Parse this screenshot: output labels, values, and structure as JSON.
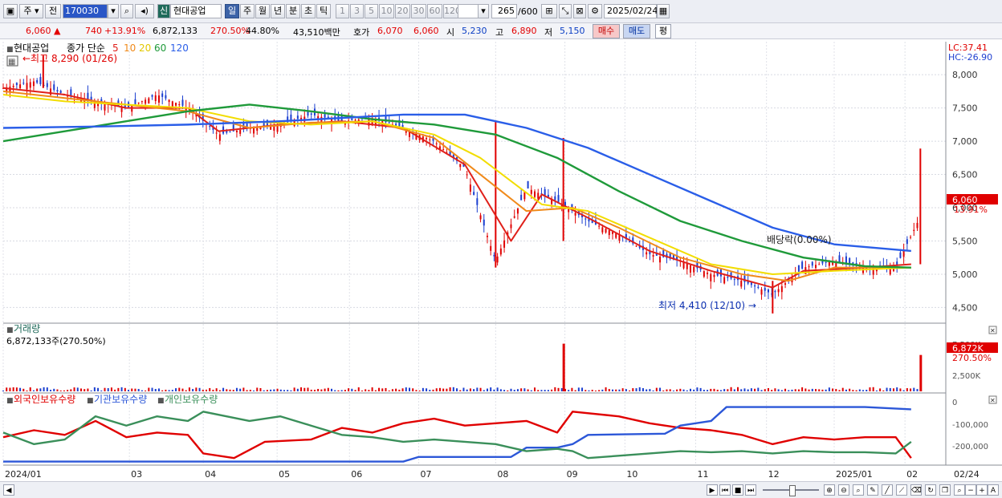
{
  "toolbar": {
    "period_label": "주",
    "prev_label": "전",
    "code": "170030",
    "sin_label": "신",
    "name": "현대공업",
    "periods": [
      "일",
      "주",
      "월",
      "년",
      "분",
      "초",
      "틱"
    ],
    "minutes": [
      "1",
      "3",
      "5",
      "10",
      "20",
      "30",
      "60",
      "120"
    ],
    "count": "265",
    "count_total": "/600",
    "date": "2025/02/24"
  },
  "quote": {
    "price": "6,060",
    "change": "740",
    "change_pct": "+13.91%",
    "volume": "6,872,133",
    "volume_pct": "270.50%",
    "turnover_pct": "44.80%",
    "amount": "43,510백만",
    "hoga_label": "호가",
    "ask": "6,070",
    "bid": "6,060",
    "open_label": "시",
    "open": "5,230",
    "high_label": "고",
    "high": "6,890",
    "low_label": "저",
    "low": "5,150",
    "buy_label": "매수",
    "sell_label": "매도",
    "avg_label": "평"
  },
  "legend": {
    "name": "현대공업",
    "ma_title": "종가 단순",
    "ma": [
      {
        "p": "5",
        "color": "#e0201a"
      },
      {
        "p": "10",
        "color": "#f08a1a"
      },
      {
        "p": "20",
        "color": "#f2dd00"
      },
      {
        "p": "60",
        "color": "#1f9a3a"
      },
      {
        "p": "120",
        "color": "#2a5ee8"
      }
    ],
    "high_note": "←최고 8,290 (01/26)",
    "low_note": "최저 4,410 (12/10) →",
    "div_note": "배당락(0.00%)",
    "lc": "LC:37.41",
    "hc": "HC:-26.90",
    "price_tag": "6,060",
    "pct_tag": "13.91%"
  },
  "volume_pane": {
    "title": "거래량",
    "value": "6,872,133주(270.50%)",
    "tag": "6,872K",
    "tag_pct": "270.50%",
    "ticks": [
      "7,500K",
      "2,500K"
    ]
  },
  "flow_pane": {
    "series": [
      {
        "name": "외국인보유수량",
        "color": "#e00000"
      },
      {
        "name": "기관보유수량",
        "color": "#2c57d8"
      },
      {
        "name": "개인보유수량",
        "color": "#3a8f5a"
      }
    ],
    "ticks": [
      "0",
      "-100,000",
      "-200,000"
    ]
  },
  "xaxis": [
    "2024/01",
    "03",
    "04",
    "05",
    "06",
    "07",
    "08",
    "09",
    "10",
    "11",
    "12",
    "2025/01",
    "02"
  ],
  "xaxis_end": "02/24",
  "chart_data": {
    "type": "line",
    "title": "현대공업",
    "ylim": [
      4300,
      8400
    ],
    "yticks": [
      4500,
      5000,
      5500,
      6000,
      6500,
      7000,
      7500,
      8000
    ],
    "x_range_weeks": [
      0,
      59
    ],
    "month_ticks": [
      {
        "label": "2024/01",
        "w": 0
      },
      {
        "label": "03",
        "w": 8.2
      },
      {
        "label": "04",
        "w": 13.0
      },
      {
        "label": "05",
        "w": 17.8
      },
      {
        "label": "06",
        "w": 22.5
      },
      {
        "label": "07",
        "w": 27.0
      },
      {
        "label": "08",
        "w": 32.0
      },
      {
        "label": "09",
        "w": 36.5
      },
      {
        "label": "10",
        "w": 40.4
      },
      {
        "label": "11",
        "w": 45.0
      },
      {
        "label": "12",
        "w": 49.6
      },
      {
        "label": "2025/01",
        "w": 54.0
      },
      {
        "label": "02",
        "w": 58.6
      }
    ],
    "series": [
      {
        "name": "종가",
        "values": [
          [
            0,
            7800
          ],
          [
            2,
            7900
          ],
          [
            4,
            7700
          ],
          [
            6,
            7600
          ],
          [
            8,
            7500
          ],
          [
            10,
            7700
          ],
          [
            12,
            7500
          ],
          [
            14,
            7100
          ],
          [
            16,
            7200
          ],
          [
            18,
            7250
          ],
          [
            20,
            7400
          ],
          [
            22,
            7300
          ],
          [
            24,
            7350
          ],
          [
            26,
            7200
          ],
          [
            28,
            7000
          ],
          [
            30,
            6600
          ],
          [
            32,
            5200
          ],
          [
            34,
            6300
          ],
          [
            36,
            6100
          ],
          [
            38,
            5800
          ],
          [
            40,
            5600
          ],
          [
            42,
            5300
          ],
          [
            44,
            5200
          ],
          [
            46,
            5000
          ],
          [
            48,
            4900
          ],
          [
            50,
            4700
          ],
          [
            52,
            5100
          ],
          [
            54,
            5200
          ],
          [
            56,
            5100
          ],
          [
            58,
            5100
          ],
          [
            60,
            6060
          ]
        ]
      },
      {
        "name": "5",
        "values": [
          [
            0,
            7800
          ],
          [
            4,
            7700
          ],
          [
            8,
            7500
          ],
          [
            12,
            7500
          ],
          [
            14,
            7150
          ],
          [
            18,
            7250
          ],
          [
            22,
            7300
          ],
          [
            26,
            7200
          ],
          [
            30,
            6650
          ],
          [
            33,
            5500
          ],
          [
            35,
            6200
          ],
          [
            38,
            5850
          ],
          [
            42,
            5350
          ],
          [
            46,
            5050
          ],
          [
            50,
            4800
          ],
          [
            52,
            5050
          ],
          [
            56,
            5100
          ],
          [
            59,
            5150
          ]
        ]
      },
      {
        "name": "10",
        "values": [
          [
            0,
            7750
          ],
          [
            4,
            7650
          ],
          [
            8,
            7550
          ],
          [
            12,
            7450
          ],
          [
            16,
            7200
          ],
          [
            20,
            7280
          ],
          [
            24,
            7300
          ],
          [
            28,
            7050
          ],
          [
            31,
            6500
          ],
          [
            34,
            5950
          ],
          [
            37,
            6000
          ],
          [
            40,
            5700
          ],
          [
            44,
            5250
          ],
          [
            48,
            5000
          ],
          [
            51,
            4900
          ],
          [
            54,
            5100
          ],
          [
            59,
            5100
          ]
        ]
      },
      {
        "name": "20",
        "values": [
          [
            0,
            7700
          ],
          [
            4,
            7600
          ],
          [
            8,
            7550
          ],
          [
            12,
            7500
          ],
          [
            16,
            7300
          ],
          [
            20,
            7250
          ],
          [
            24,
            7300
          ],
          [
            28,
            7100
          ],
          [
            31,
            6750
          ],
          [
            35,
            6050
          ],
          [
            38,
            5950
          ],
          [
            42,
            5550
          ],
          [
            46,
            5150
          ],
          [
            50,
            5000
          ],
          [
            54,
            5050
          ],
          [
            59,
            5100
          ]
        ]
      },
      {
        "name": "60",
        "values": [
          [
            0,
            7000
          ],
          [
            4,
            7150
          ],
          [
            8,
            7300
          ],
          [
            12,
            7450
          ],
          [
            16,
            7550
          ],
          [
            20,
            7450
          ],
          [
            24,
            7330
          ],
          [
            28,
            7250
          ],
          [
            32,
            7100
          ],
          [
            36,
            6750
          ],
          [
            40,
            6250
          ],
          [
            44,
            5800
          ],
          [
            48,
            5500
          ],
          [
            52,
            5250
          ],
          [
            56,
            5120
          ],
          [
            59,
            5100
          ]
        ]
      },
      {
        "name": "120",
        "values": [
          [
            0,
            7200
          ],
          [
            6,
            7220
          ],
          [
            12,
            7250
          ],
          [
            18,
            7300
          ],
          [
            22,
            7350
          ],
          [
            26,
            7400
          ],
          [
            30,
            7400
          ],
          [
            34,
            7200
          ],
          [
            38,
            6900
          ],
          [
            42,
            6500
          ],
          [
            46,
            6100
          ],
          [
            50,
            5700
          ],
          [
            54,
            5450
          ],
          [
            59,
            5350
          ]
        ]
      }
    ],
    "volume_K": {
      "ylim": [
        0,
        10000
      ],
      "spikes": [
        {
          "w": 36.4,
          "v": 9000
        },
        {
          "w": 59.6,
          "v": 6872
        }
      ]
    },
    "flow": {
      "ylim": [
        -260000,
        20000
      ],
      "series": [
        {
          "name": "외국인보유수량",
          "values": [
            [
              0,
              -150000
            ],
            [
              2,
              -120000
            ],
            [
              4,
              -140000
            ],
            [
              6,
              -80000
            ],
            [
              8,
              -150000
            ],
            [
              10,
              -130000
            ],
            [
              12,
              -140000
            ],
            [
              13,
              -220000
            ],
            [
              15,
              -240000
            ],
            [
              17,
              -170000
            ],
            [
              20,
              -160000
            ],
            [
              22,
              -110000
            ],
            [
              24,
              -130000
            ],
            [
              26,
              -90000
            ],
            [
              28,
              -70000
            ],
            [
              30,
              -100000
            ],
            [
              32,
              -90000
            ],
            [
              34,
              -80000
            ],
            [
              36,
              -130000
            ],
            [
              37,
              -40000
            ],
            [
              40,
              -60000
            ],
            [
              42,
              -90000
            ],
            [
              44,
              -110000
            ],
            [
              46,
              -120000
            ],
            [
              48,
              -140000
            ],
            [
              50,
              -180000
            ],
            [
              52,
              -150000
            ],
            [
              54,
              -160000
            ],
            [
              56,
              -150000
            ],
            [
              58,
              -150000
            ],
            [
              59,
              -240000
            ]
          ]
        },
        {
          "name": "기관보유수량",
          "values": [
            [
              0,
              -255000
            ],
            [
              12,
              -255000
            ],
            [
              22,
              -255000
            ],
            [
              26,
              -255000
            ],
            [
              27,
              -235000
            ],
            [
              33,
              -235000
            ],
            [
              34,
              -195000
            ],
            [
              36,
              -195000
            ],
            [
              37,
              -180000
            ],
            [
              38,
              -140000
            ],
            [
              43,
              -135000
            ],
            [
              44,
              -100000
            ],
            [
              46,
              -80000
            ],
            [
              47,
              -20000
            ],
            [
              52,
              -20000
            ],
            [
              56,
              -20000
            ],
            [
              59,
              -30000
            ]
          ]
        },
        {
          "name": "개인보유수량",
          "values": [
            [
              0,
              -130000
            ],
            [
              2,
              -180000
            ],
            [
              4,
              -160000
            ],
            [
              6,
              -60000
            ],
            [
              8,
              -100000
            ],
            [
              10,
              -60000
            ],
            [
              12,
              -80000
            ],
            [
              13,
              -40000
            ],
            [
              16,
              -80000
            ],
            [
              18,
              -60000
            ],
            [
              20,
              -100000
            ],
            [
              22,
              -140000
            ],
            [
              24,
              -150000
            ],
            [
              26,
              -170000
            ],
            [
              28,
              -160000
            ],
            [
              30,
              -170000
            ],
            [
              32,
              -180000
            ],
            [
              34,
              -210000
            ],
            [
              36,
              -200000
            ],
            [
              37,
              -210000
            ],
            [
              38,
              -240000
            ],
            [
              40,
              -230000
            ],
            [
              42,
              -220000
            ],
            [
              44,
              -210000
            ],
            [
              46,
              -215000
            ],
            [
              48,
              -210000
            ],
            [
              50,
              -220000
            ],
            [
              52,
              -210000
            ],
            [
              54,
              -215000
            ],
            [
              56,
              -215000
            ],
            [
              58,
              -220000
            ],
            [
              59,
              -170000
            ]
          ]
        }
      ]
    }
  }
}
